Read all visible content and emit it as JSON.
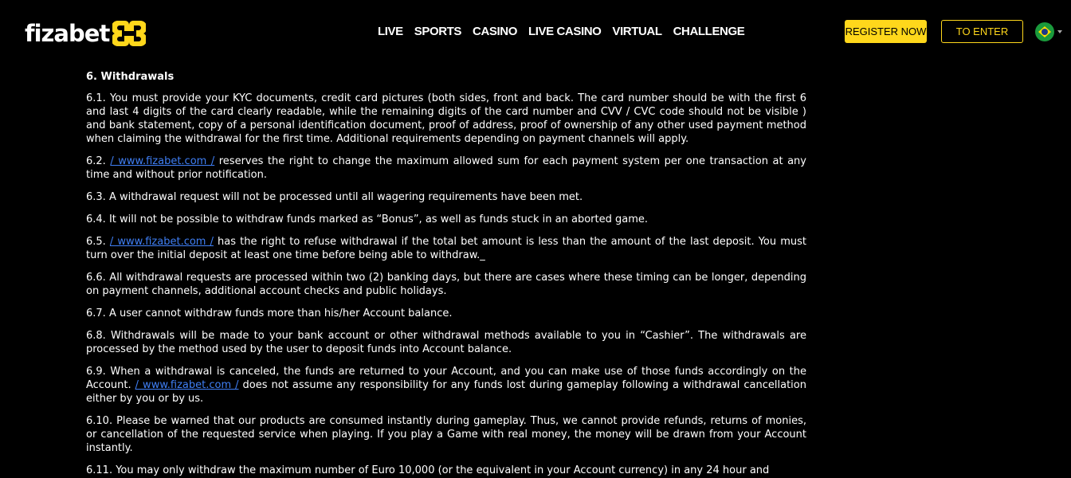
{
  "header": {
    "logo": {
      "text_fiza": "fiza",
      "text_bet": "bet",
      "mark_icon": "fizabet-logo-mark-icon"
    },
    "nav": [
      {
        "label": "LIVE"
      },
      {
        "label": "SPORTS"
      },
      {
        "label": "CASINO"
      },
      {
        "label": "LIVE CASINO"
      },
      {
        "label": "VIRTUAL"
      },
      {
        "label": "CHALLENGE"
      }
    ],
    "register_label": "REGISTER NOW",
    "enter_label": "TO ENTER",
    "language_icon": "brazil-flag-icon"
  },
  "colors": {
    "accent": "#ffd71b",
    "link": "#3f7ff5",
    "background": "#000000",
    "text": "#ffffff"
  },
  "content": {
    "title": "6. Withdrawals",
    "p1": "6.1. You must provide your KYC documents, credit card pictures (both sides, front and back. The card number should be with the first 6 and last 4 digits of the card clearly readable, while the remaining digits of the card number and CVV / CVC code should not be visible ) and bank statement, copy of a personal identification document, proof of address, proof of ownership of any other used payment method when claiming the withdrawal for the first time. Additional requirements depending on payment channels will apply.",
    "p2_prefix": "6.2. ",
    "p2_link": "/ www.fizabet.com /",
    "p2_rest": " reserves the right to change the maximum allowed sum for each payment system per one transaction at any time and without prior notification.",
    "p3": "6.3. A withdrawal request will not be processed until all wagering requirements have been met.",
    "p4": "6.4. It will not be possible to withdraw funds marked as “Bonus”, as well as funds stuck in an aborted game.",
    "p5_prefix": "6.5. ",
    "p5_link": "/ www.fizabet.com /",
    "p5_rest": " has the right to refuse withdrawal if the total bet amount is less than the amount of the last deposit. You must turn over the initial deposit at least one time before being able to withdraw._",
    "p6": "6.6. All withdrawal requests are processed within two (2) banking days, but there are cases where these timing can be longer, depending on payment channels, additional account checks and public holidays.",
    "p7": "6.7. A user cannot withdraw funds more than his/her Account balance.",
    "p8": "6.8. Withdrawals will be made to your bank account or other withdrawal methods available to you in “Cashier”. The withdrawals are processed by the method used by the user to deposit funds into Account balance.",
    "p9_prefix": "6.9. When a withdrawal is canceled, the funds are returned to your Account, and you can make use of those funds accordingly on the Account. ",
    "p9_link": "/ www.fizabet.com /",
    "p9_rest": " does not assume any responsibility for any funds lost during gameplay following a withdrawal cancellation either by you or by us.",
    "p10": "6.10. Please be warned that our products are consumed instantly during gameplay. Thus, we cannot provide refunds, returns of monies, or cancellation of the requested service when playing. If you play a Game with real money, the money will be drawn from your Account instantly.",
    "p11": "6.11. You may only withdraw the maximum number of Euro 10,000 (or the equivalent in your Account currency) in any 24 hour and"
  }
}
